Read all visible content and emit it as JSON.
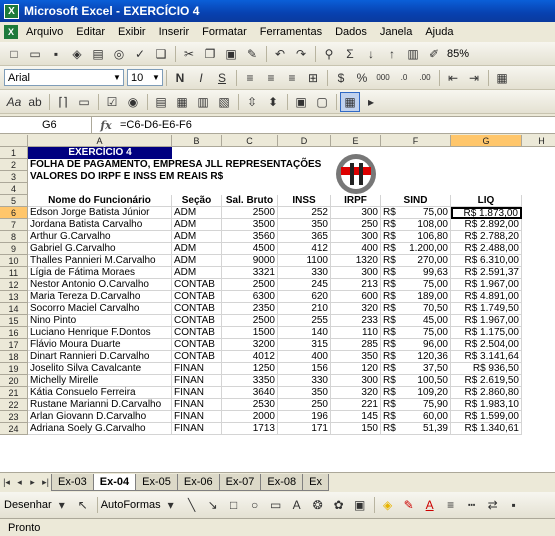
{
  "window": {
    "title": "Microsoft Excel - EXERCÍCIO 4"
  },
  "menu": [
    "Arquivo",
    "Editar",
    "Exibir",
    "Inserir",
    "Formatar",
    "Ferramentas",
    "Dados",
    "Janela",
    "Ajuda"
  ],
  "toolbar": {
    "zoom": "85%",
    "font_name": "Arial",
    "font_size": "10"
  },
  "formula_bar": {
    "cell_ref": "G6",
    "fx": "fx",
    "formula": "=C6-D6-E6-F6"
  },
  "columns": [
    "A",
    "B",
    "C",
    "D",
    "E",
    "F",
    "G",
    "H"
  ],
  "sheet": {
    "title_row": "EXERCÍCIO 4",
    "line2": "FOLHA DE PAGAMENTO, EMPRESA JLL REPRESENTAÇÕES",
    "line3": "VALORES DO IRPF E INSS EM REAIS R$",
    "headers": [
      "Nome do Funcionário",
      "Seção",
      "Sal. Bruto",
      "INSS",
      "IRPF",
      "SIND",
      "LIQ"
    ],
    "rows": [
      [
        "Edson Jorge Batista Júnior",
        "ADM",
        "2500",
        "252",
        "300",
        "R$",
        "75,00",
        "R$ 1.873,00"
      ],
      [
        "Jordana Batista Carvalho",
        "ADM",
        "3500",
        "350",
        "250",
        "R$",
        "108,00",
        "R$ 2.892,00"
      ],
      [
        "Arthur G.Carvalho",
        "ADM",
        "3560",
        "365",
        "300",
        "R$",
        "106,80",
        "R$ 2.788,20"
      ],
      [
        "Gabriel G.Carvalho",
        "ADM",
        "4500",
        "412",
        "400",
        "R$",
        "1.200,00",
        "R$ 2.488,00"
      ],
      [
        "Thalles Pannieri M.Carvalho",
        "ADM",
        "9000",
        "1100",
        "1320",
        "R$",
        "270,00",
        "R$ 6.310,00"
      ],
      [
        "Lígia de Fátima Moraes",
        "ADM",
        "3321",
        "330",
        "300",
        "R$",
        "99,63",
        "R$ 2.591,37"
      ],
      [
        "Nestor Antonio O.Carvalho",
        "CONTAB",
        "2500",
        "245",
        "213",
        "R$",
        "75,00",
        "R$ 1.967,00"
      ],
      [
        "Maria Tereza D.Carvalho",
        "CONTAB",
        "6300",
        "620",
        "600",
        "R$",
        "189,00",
        "R$ 4.891,00"
      ],
      [
        "Socorro Maciel Carvalho",
        "CONTAB",
        "2350",
        "210",
        "320",
        "R$",
        "70,50",
        "R$ 1.749,50"
      ],
      [
        "Nino Pinto",
        "CONTAB",
        "2500",
        "255",
        "233",
        "R$",
        "45,00",
        "R$ 1.967,00"
      ],
      [
        "Luciano Henrique F.Dontos",
        "CONTAB",
        "1500",
        "140",
        "110",
        "R$",
        "75,00",
        "R$ 1.175,00"
      ],
      [
        "Flávio Moura Duarte",
        "CONTAB",
        "3200",
        "315",
        "285",
        "R$",
        "96,00",
        "R$ 2.504,00"
      ],
      [
        "Dinart Rannieri D.Carvalho",
        "CONTAB",
        "4012",
        "400",
        "350",
        "R$",
        "120,36",
        "R$ 3.141,64"
      ],
      [
        "Joselito Silva Cavalcante",
        "FINAN",
        "1250",
        "156",
        "120",
        "R$",
        "37,50",
        "R$ 936,50"
      ],
      [
        "Michelly Mirelle",
        "FINAN",
        "3350",
        "330",
        "300",
        "R$",
        "100,50",
        "R$ 2.619,50"
      ],
      [
        "Kátia Consuelo Ferreira",
        "FINAN",
        "3640",
        "350",
        "320",
        "R$",
        "109,20",
        "R$ 2.860,80"
      ],
      [
        "Rustane Marianni D.Carvalho",
        "FINAN",
        "2530",
        "250",
        "221",
        "R$",
        "75,90",
        "R$ 1.983,10"
      ],
      [
        "Arlan Giovann D.Carvalho",
        "FINAN",
        "2000",
        "196",
        "145",
        "R$",
        "60,00",
        "R$ 1.599,00"
      ],
      [
        "Adriana Soely G.Carvalho",
        "FINAN",
        "1713",
        "171",
        "150",
        "R$",
        "51,39",
        "R$ 1.340,61"
      ]
    ]
  },
  "sheet_tabs": [
    "Ex-03",
    "Ex-04",
    "Ex-05",
    "Ex-06",
    "Ex-07",
    "Ex-08",
    "Ex"
  ],
  "active_tab": "Ex-04",
  "draw_toolbar": {
    "draw_label": "Desenhar",
    "autoshapes_label": "AutoFormas"
  },
  "status": {
    "text": "Pronto"
  },
  "colors": {
    "title_bg": "#000080",
    "title_fg": "#ffffff",
    "selected_border": "#000000"
  }
}
